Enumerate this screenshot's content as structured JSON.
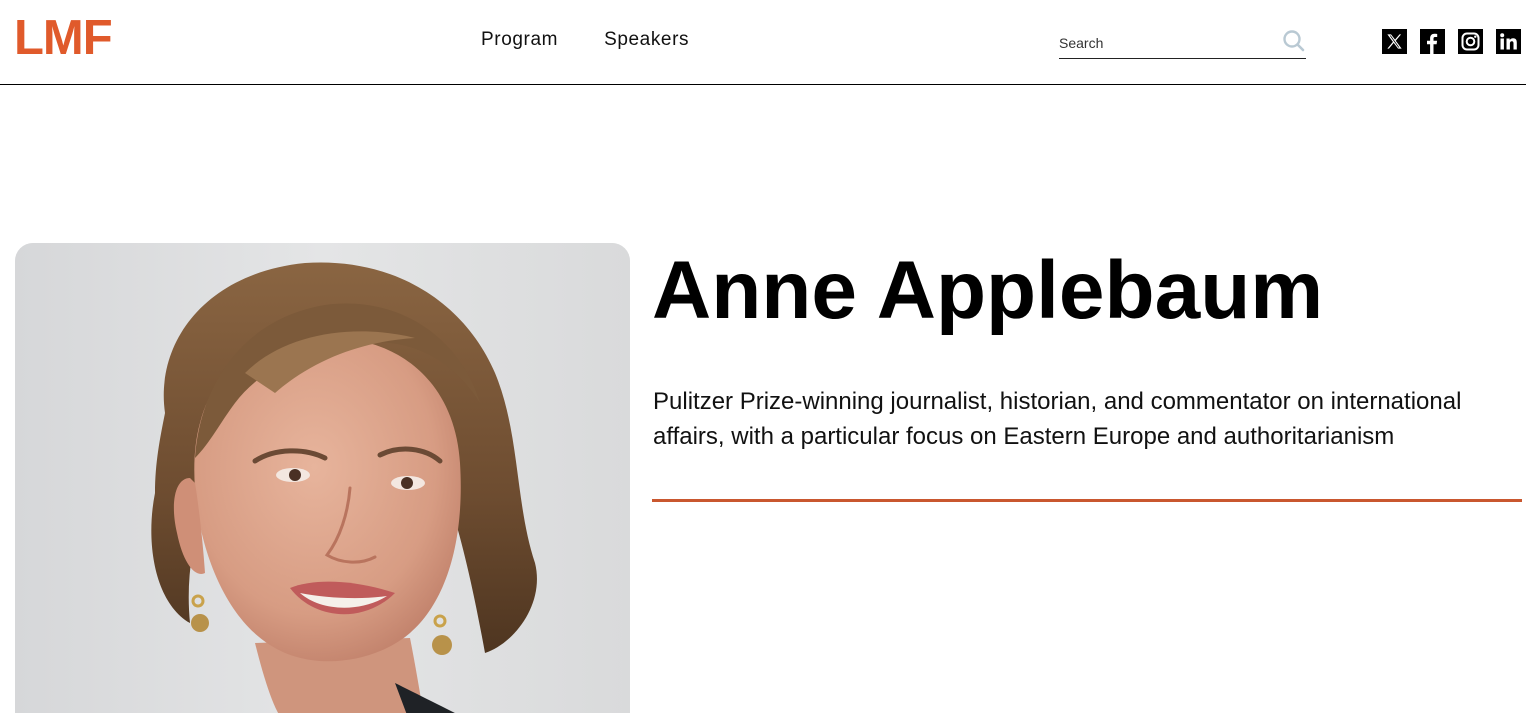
{
  "header": {
    "logo": "LMF",
    "nav": [
      {
        "label": "Program"
      },
      {
        "label": "Speakers"
      }
    ],
    "search": {
      "placeholder": "Search",
      "value": "",
      "icon": "search-icon"
    },
    "social": [
      {
        "icon": "x-twitter-icon"
      },
      {
        "icon": "facebook-icon"
      },
      {
        "icon": "instagram-icon"
      },
      {
        "icon": "linkedin-icon"
      }
    ]
  },
  "speaker": {
    "name": "Anne Applebaum",
    "bio": "Pulitzer Prize-winning journalist, historian, and commentator on international affairs, with a particular focus on Eastern Europe and authoritarianism"
  },
  "colors": {
    "brand": "#e05a2b",
    "rule": "#c9572f",
    "text": "#000000",
    "photo_background": "#e1e2e3"
  }
}
